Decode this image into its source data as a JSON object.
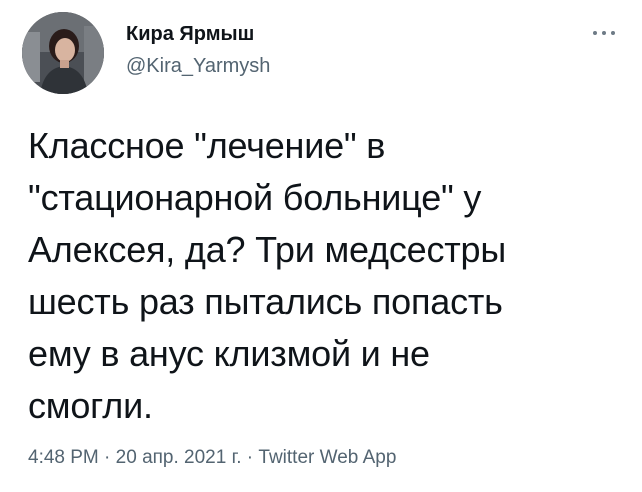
{
  "author": {
    "name": "Кира Ярмыш",
    "handle": "@Kira_Yarmysh"
  },
  "tweet": {
    "text": "Классное \"лечение\" в\n\"стационарной больнице\" у\nАлексея, да? Три медсестры\nшесть раз пытались попасть\nему в анус клизмой и не\nсмогли."
  },
  "meta": {
    "time": "4:48 PM",
    "date": "20 апр. 2021 г.",
    "source": "Twitter Web App",
    "separator": " · "
  },
  "icons": {
    "more": "more-dots-icon"
  }
}
